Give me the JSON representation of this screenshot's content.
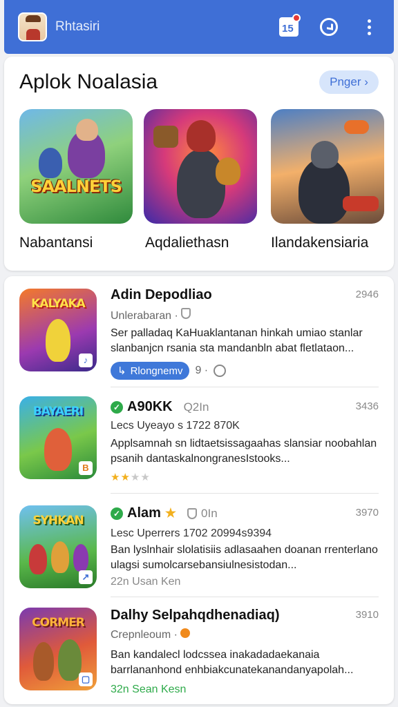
{
  "app": {
    "title": "Rhtasiri"
  },
  "featured": {
    "title": "Aplok Noalasia",
    "button_label": "Pnger ›",
    "items": [
      {
        "label": "Nabantansi",
        "art_text": "SAALNETS"
      },
      {
        "label": "Aqdaliethasn"
      },
      {
        "label": "Ilandakensiaria"
      }
    ]
  },
  "list": {
    "items": [
      {
        "title": "Adin Depodliao",
        "number": "2946",
        "sub": "Unlerabaran ·",
        "desc": "Ser palladaq KaHuaklantanan hinkah umiao stanlar slanbanjcn rsania sta mandanbln abat fletlataon...",
        "pill": "Rlongnemv",
        "meta_extra": "9 ·",
        "icon_text": "KALYAKA"
      },
      {
        "title": "A90KK",
        "title_extra": "Q2In",
        "number": "3436",
        "sub": "Lecs Uyeayo s 1722 870K",
        "desc": "Applsamnah sn lidtaetsissagaahas slansiar noobahlan psanih dantaskalnongranesIstooks...",
        "rating": 2,
        "icon_text": "BAYAERI"
      },
      {
        "title": "Alam",
        "title_extra": "0In",
        "number": "3970",
        "sub": "Lesc Uperrers 1702 20994s9394",
        "desc": "Ban lyslnhair slolatisiis adlasaahen doanan rrenterlano ulagsi sumolcarsebansiulnesistodan...",
        "meta": "22n Usan Ken",
        "icon_text": "SYHKAN"
      },
      {
        "title": "Dalhy Selpahqdhenadiaq)",
        "number": "3910",
        "sub": "Crepnleoum ·",
        "desc": "Ban kandalecl lodcssea inakadadaekanaia barrlananhond enhbiakcunatekanandanyapolah...",
        "meta": "32n Sean Kesn",
        "icon_text": "CORMER"
      }
    ]
  },
  "colors": {
    "primary": "#3f6fd6",
    "accent_green": "#2eaa4a",
    "star": "#f2b01e"
  }
}
